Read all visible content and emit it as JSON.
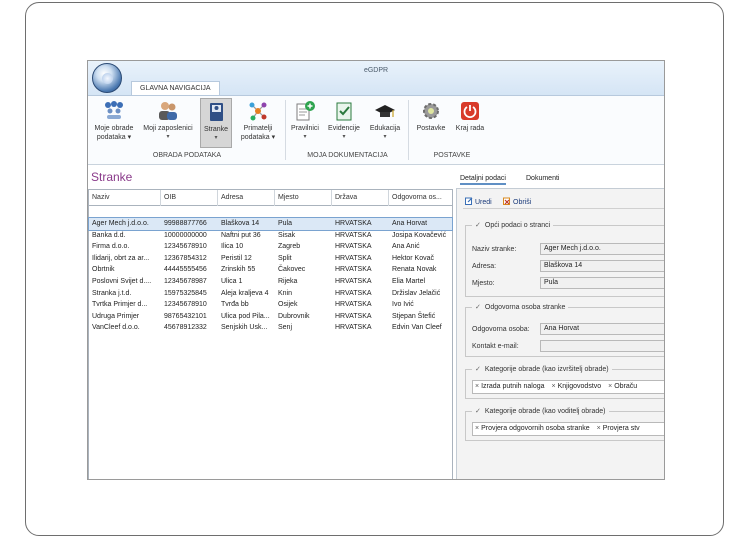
{
  "app": {
    "title": "eGDPR",
    "nav_tab": "GLAVNA NAVIGACIJA"
  },
  "ribbon": {
    "groups": [
      {
        "label": "OBRADA PODATAKA"
      },
      {
        "label": "MOJA DOKUMENTACIJA"
      },
      {
        "label": "POSTAVKE"
      }
    ],
    "buttons": {
      "moje_obrade": {
        "line1": "Moje obrade",
        "line2": "podataka ▾"
      },
      "moji_zaposlenici": {
        "line1": "Moji zaposlenici",
        "line2": "▾"
      },
      "stranke": {
        "line1": "Stranke",
        "line2": "▾"
      },
      "primatelji": {
        "line1": "Primatelji",
        "line2": "podataka ▾"
      },
      "pravilnici": {
        "line1": "Pravilnici",
        "line2": "▾"
      },
      "evidencije": {
        "line1": "Evidencije",
        "line2": "▾"
      },
      "edukacija": {
        "line1": "Edukacija",
        "line2": "▾"
      },
      "postavke": {
        "line1": "Postavke",
        "line2": ""
      },
      "kraj_rada": {
        "line1": "Kraj rada",
        "line2": ""
      }
    }
  },
  "left": {
    "page_title": "Stranke",
    "columns": [
      "Naziv",
      "OIB",
      "Adresa",
      "Mjesto",
      "Država",
      "Odgovorna os..."
    ],
    "rows": [
      [
        "Ager Mech j.d.o.o.",
        "99988877766",
        "Blaškova 14",
        "Pula",
        "HRVATSKA",
        "Ana Horvat"
      ],
      [
        "Banka d.d.",
        "10000000000",
        "Naftni put 36",
        "Sisak",
        "HRVATSKA",
        "Josipa Kovačević"
      ],
      [
        "Firma d.o.o.",
        "12345678910",
        "Ilica 10",
        "Zagreb",
        "HRVATSKA",
        "Ana Anić"
      ],
      [
        "Ilidarij, obrt za ar...",
        "12367854312",
        "Peristil 12",
        "Split",
        "HRVATSKA",
        "Hektor Kovač"
      ],
      [
        "Obrtnik",
        "44445555456",
        "Zrinskih 55",
        "Čakovec",
        "HRVATSKA",
        "Renata Novak"
      ],
      [
        "Poslovni Svijet d....",
        "12345678987",
        "Ulica 1",
        "Rijeka",
        "HRVATSKA",
        "Elia Martel"
      ],
      [
        "Stranka j.t.d.",
        "15975325845",
        "Aleja kraljeva 4",
        "Knin",
        "HRVATSKA",
        "Držislav Jelačić"
      ],
      [
        "Tvrtka Primjer d...",
        "12345678910",
        "Tvrđa bb",
        "Osijek",
        "HRVATSKA",
        "Ivo Ivić"
      ],
      [
        "Udruga Primjer",
        "98765432101",
        "Ulica pod Pila...",
        "Dubrovnik",
        "HRVATSKA",
        "Stjepan Štefić"
      ],
      [
        "VanCleef d.o.o.",
        "45678912332",
        "Senjskih Usk...",
        "Senj",
        "HRVATSKA",
        "Edvin Van Cleef"
      ]
    ]
  },
  "right": {
    "tabs": [
      "Detaljni podaci",
      "Dokumenti"
    ],
    "toolbar": {
      "edit": "Uredi",
      "delete": "Obriši"
    },
    "general": {
      "title": "Opći podaci o stranci",
      "naziv_label": "Naziv stranke:",
      "naziv_value": "Ager Mech j.d.o.o.",
      "adresa_label": "Adresa:",
      "adresa_value": "Blaškova 14",
      "mjesto_label": "Mjesto:",
      "mjesto_value": "Pula"
    },
    "contact": {
      "title": "Odgovorna osoba stranke",
      "osoba_label": "Odgovorna osoba:",
      "osoba_value": "Ana Horvat",
      "email_label": "Kontakt e-mail:",
      "email_value": ""
    },
    "cat_executor": {
      "title": "Kategorije obrade (kao izvršitelj obrade)",
      "tags": [
        "Izrada putnih naloga",
        "Knjigovodstvo",
        "Obraču"
      ]
    },
    "cat_controller": {
      "title": "Kategorije obrade (kao voditelj obrade)",
      "tags": [
        "Provjera odgovornih osoba stranke",
        "Provjera stv"
      ]
    }
  }
}
